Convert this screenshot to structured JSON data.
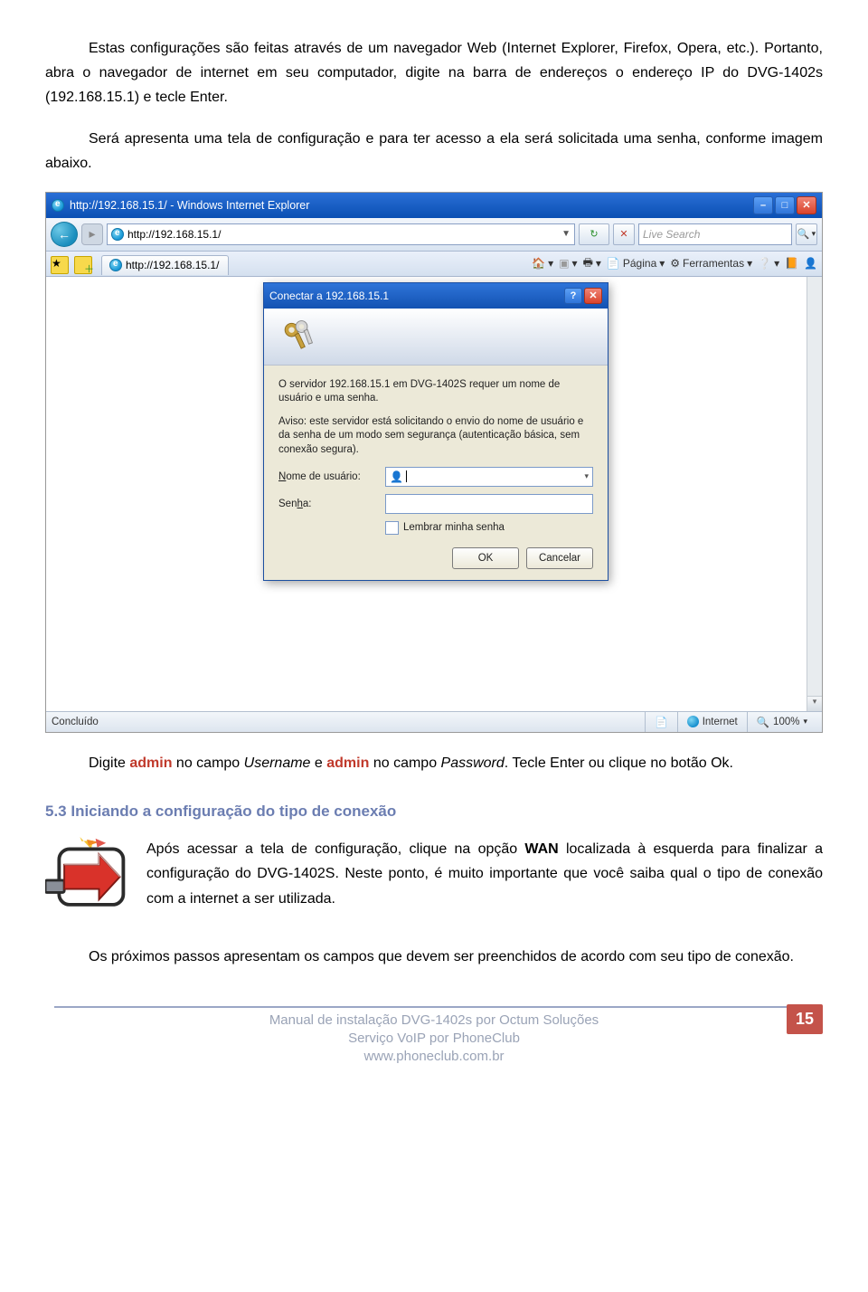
{
  "doc": {
    "p1": "Estas configurações são feitas através de um navegador Web (Internet Explorer, Firefox, Opera, etc.). Portanto, abra o navegador de internet em seu computador, digite na barra de endereços o endereço IP do DVG-1402s (192.168.15.1) e tecle Enter.",
    "p2": "Será apresenta uma tela de configuração e para ter acesso a ela será solicitada uma senha, conforme imagem abaixo.",
    "p3_pre": "Digite ",
    "p3_admin1": "admin",
    "p3_mid1": " no campo ",
    "p3_user": "Username",
    "p3_mid2": " e ",
    "p3_admin2": "admin",
    "p3_mid3": " no campo ",
    "p3_pass": "Password",
    "p3_post": ". Tecle Enter ou clique no botão Ok.",
    "section": "5.3 Iniciando a configuração do tipo de conexão",
    "wan_pre": "Após acessar a tela de configuração, clique na opção ",
    "wan": "WAN",
    "wan_post": " localizada à esquerda para finalizar a configuração do DVG-1402S. Neste ponto, é muito importante que você saiba qual o tipo de conexão com a internet a ser utilizada.",
    "p5": "Os próximos passos apresentam os campos que devem ser preenchidos de acordo com seu tipo de conexão."
  },
  "ie": {
    "title": "http://192.168.15.1/ - Windows Internet Explorer",
    "address": "http://192.168.15.1/",
    "search_placeholder": "Live Search",
    "tab": "http://192.168.15.1/",
    "tool_pagina": "Página",
    "tool_ferramentas": "Ferramentas",
    "status_left": "Concluído",
    "status_zone": "Internet",
    "status_zoom": "100%"
  },
  "dialog": {
    "title": "Conectar a 192.168.15.1",
    "msg1": "O servidor 192.168.15.1 em DVG-1402S requer um nome de usuário e uma senha.",
    "msg2": "Aviso: este servidor está solicitando o envio do nome de usuário e da senha de um modo sem segurança (autenticação básica, sem conexão segura).",
    "user_label_pre": "N",
    "user_label_post": "ome de usuário:",
    "user_value": "",
    "pass_label_pre": "Sen",
    "pass_label_post": "a:",
    "pass_u": "h",
    "remember_pre": "L",
    "remember_post": "embrar minha senha",
    "ok": "OK",
    "cancel": "Cancelar"
  },
  "footer": {
    "l1": "Manual de instalação DVG-1402s por Octum Soluções",
    "l2": "Serviço VoIP por PhoneClub",
    "l3": "www.phoneclub.com.br",
    "page": "15"
  }
}
